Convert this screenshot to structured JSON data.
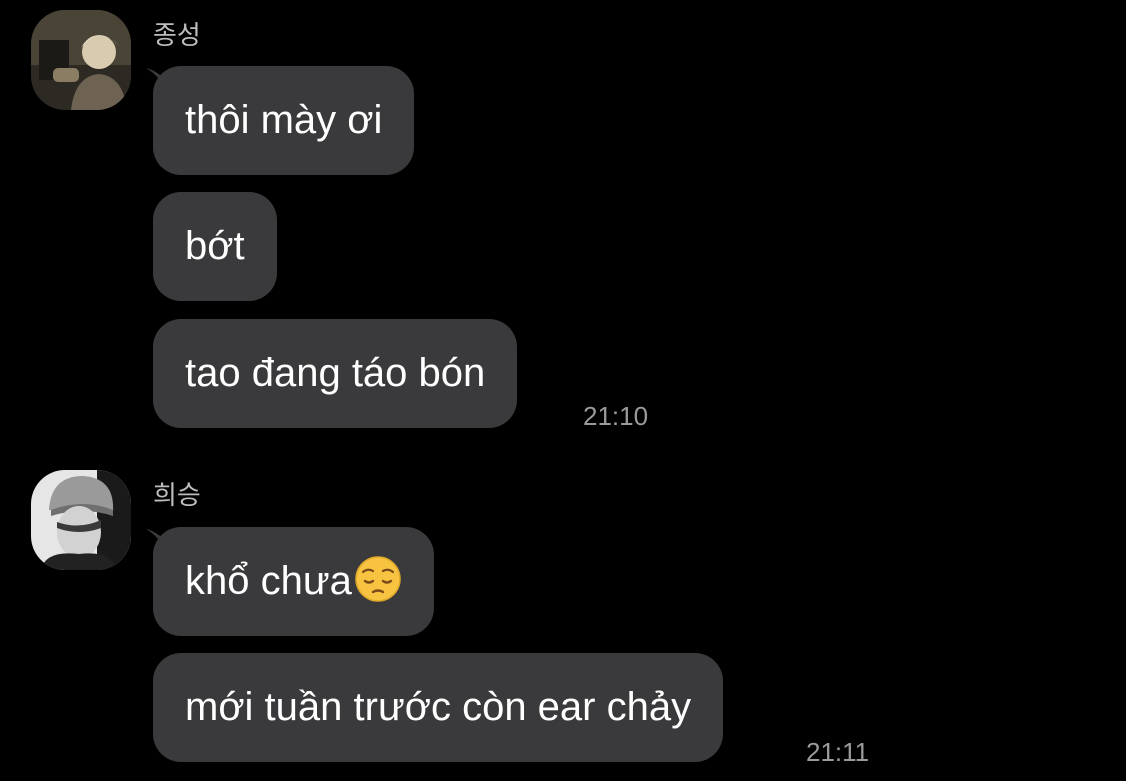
{
  "conversation": [
    {
      "sender": "종성",
      "avatar_icon": "avatar-photo-light",
      "messages": [
        "thôi mày ơi",
        "bớt",
        "tao đang táo bón"
      ],
      "time": "21:10"
    },
    {
      "sender": "희승",
      "avatar_icon": "avatar-photo-monochrome",
      "messages": [
        "khổ chưa",
        "mới tuần trước còn ear chảy"
      ],
      "emoji": "pensive-face-emoji",
      "time": "21:11"
    }
  ],
  "colors": {
    "background": "#000000",
    "bubble": "#3a3a3c",
    "message_text": "#ffffff",
    "sender_text": "#bdbdbd",
    "timestamp_text": "#9a9a9a",
    "emoji_face": "#f7c341"
  }
}
